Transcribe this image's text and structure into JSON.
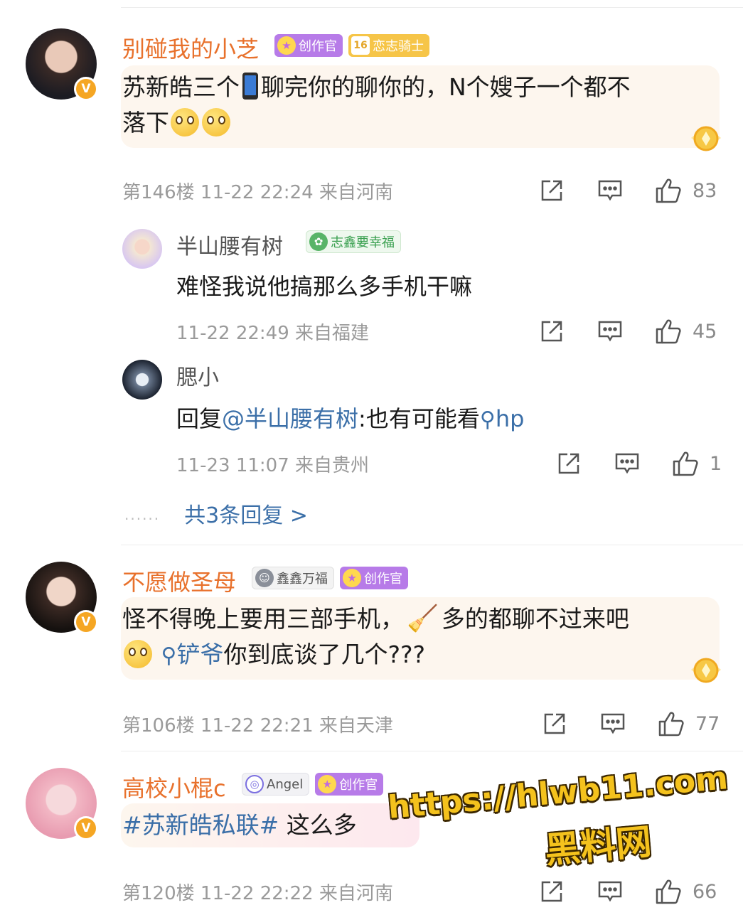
{
  "comments": [
    {
      "username": "别碰我的小芝",
      "badges": [
        {
          "icon": "creator-icon",
          "label": "创作官"
        },
        {
          "icon": "level-16-icon",
          "glyph": "16",
          "label": "恋志骑士"
        }
      ],
      "text_before_phone": "苏新皓三个",
      "text_after_phone": "聊完你的聊你的，N个嫂子一个都不",
      "text_line2": "落下",
      "emoji": "flushed-face-emoji",
      "floor": "第146楼",
      "time": "11-22 22:24",
      "location": "来自河南",
      "likes": "83"
    },
    {
      "username": "不愿做圣母",
      "badges": [
        {
          "icon": "smile-icon",
          "label": "鑫鑫万福"
        },
        {
          "icon": "creator-icon",
          "label": "创作官"
        }
      ],
      "text_line1": "怪不得晚上要用三部手机，",
      "text_line1_after": "多的都聊不过来吧",
      "search_link": "铲爷",
      "text_line2_after": "你到底谈了几个???",
      "floor": "第106楼",
      "time": "11-22 22:21",
      "location": "来自天津",
      "likes": "77"
    },
    {
      "username": "高校小棍c",
      "badges": [
        {
          "icon": "angel-icon",
          "label": "Angel"
        },
        {
          "icon": "creator-icon",
          "label": "创作官"
        }
      ],
      "topic": "#苏新皓私联#",
      "text_after_topic": " 这么多",
      "floor": "第120楼",
      "time": "11-22 22:22",
      "location": "来自河南",
      "likes": "66"
    }
  ],
  "replies": [
    {
      "username": "半山腰有树",
      "badge": {
        "icon": "clover-icon",
        "label": "志鑫要幸福"
      },
      "text": "难怪我说他搞那么多手机干嘛",
      "time": "11-22 22:49",
      "location": "来自福建",
      "likes": "45"
    },
    {
      "username": "腮小",
      "reply_prefix": "回复",
      "mention": "@半山腰有树",
      "text": ":也有可能看",
      "search_link": "hp",
      "time": "11-23 11:07",
      "location": "来自贵州",
      "likes": "1"
    }
  ],
  "more_replies": "共3条回复 >",
  "more_dots": "......",
  "watermark": {
    "url": "https://hlwb11.com",
    "site": "黑料网"
  },
  "colors": {
    "username": "#e8712c",
    "link": "#3b6fa8",
    "meta": "#9a9a9a",
    "bubble": "#fdf6ee"
  }
}
